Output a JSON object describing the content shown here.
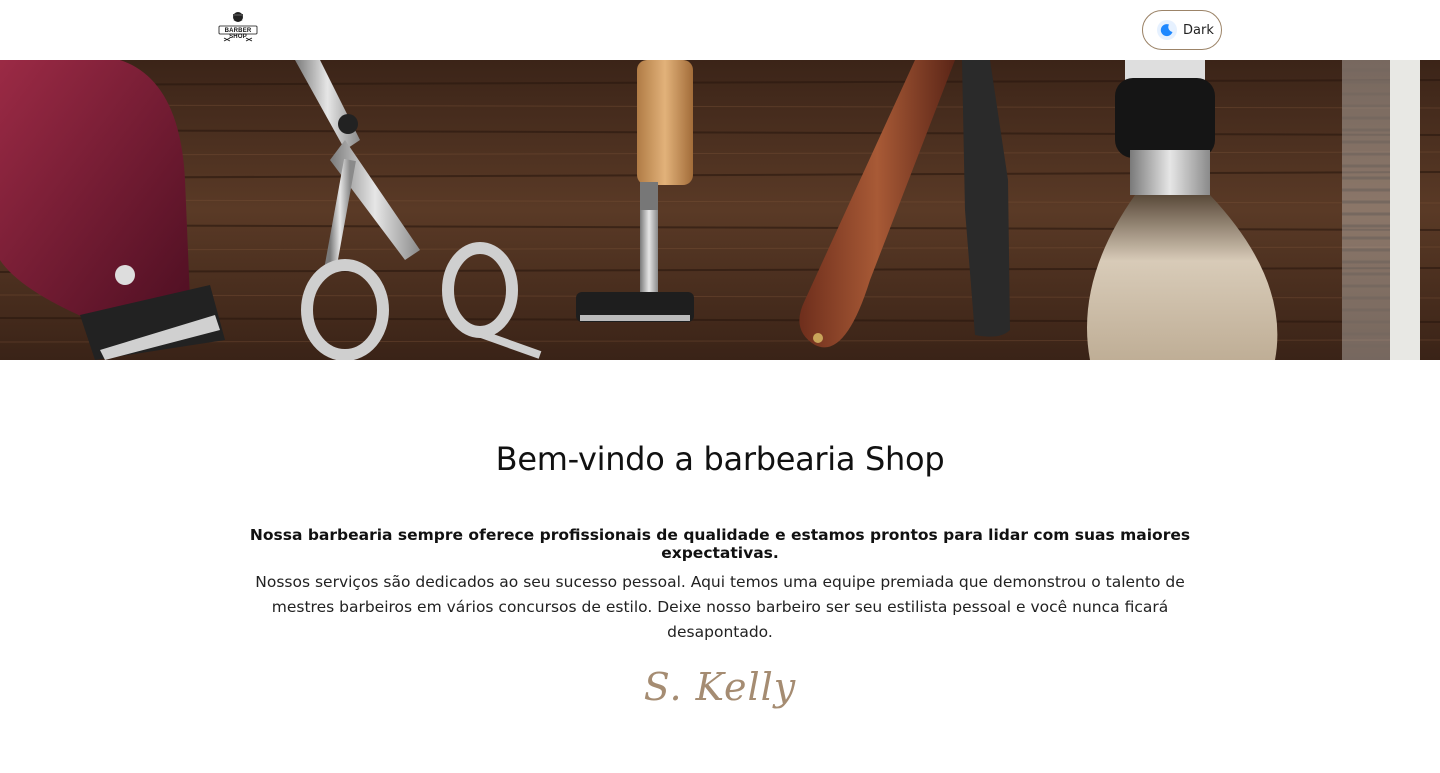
{
  "header": {
    "logo": {
      "text": "BARBER SHOP",
      "icon": "barber-logo-icon"
    },
    "theme_toggle": {
      "label": "Dark",
      "icon": "moon-icon"
    }
  },
  "hero": {
    "icons": [
      "hair-clipper-icon",
      "scissors-icon",
      "safety-razor-icon",
      "straight-razor-icon",
      "shaving-brush-icon",
      "comb-icon"
    ]
  },
  "main": {
    "title": "Bem-vindo a barbearia Shop",
    "lead": "Nossa barbearia sempre oferece profissionais de qualidade e estamos prontos para lidar com suas maiores expectativas.",
    "body": "Nossos serviços são dedicados ao seu sucesso pessoal. Aqui temos uma equipe premiada que demonstrou o talento de mestres barbeiros em vários concursos de estilo. Deixe nosso barbeiro ser seu estilista pessoal e você nunca ficará desapontado.",
    "signature": "S. Kelly"
  },
  "colors": {
    "accent": "#a58c72",
    "toggle_border": "#9c8468",
    "wood": "#4a2f1f"
  }
}
